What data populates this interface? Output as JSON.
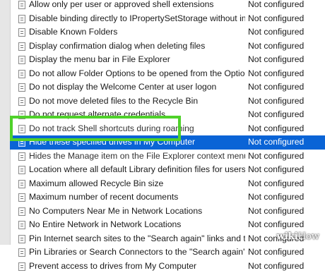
{
  "policy_list": {
    "rows": [
      {
        "name": "Allow only per user or approved shell extensions",
        "state": "Not configured"
      },
      {
        "name": "Disable binding directly to IPropertySetStorage without interm...",
        "state": "Not configured"
      },
      {
        "name": "Disable Known Folders",
        "state": "Not configured"
      },
      {
        "name": "Display confirmation dialog when deleting files",
        "state": "Not configured"
      },
      {
        "name": "Display the menu bar in File Explorer",
        "state": "Not configured"
      },
      {
        "name": "Do not allow Folder Options to be opened from the Options b...",
        "state": "Not configured"
      },
      {
        "name": "Do not display the Welcome Center at user logon",
        "state": "Not configured"
      },
      {
        "name": "Do not move deleted files to the Recycle Bin",
        "state": "Not configured"
      },
      {
        "name": "Do not request alternate credentials",
        "state": "Not configured"
      },
      {
        "name": "Do not track Shell shortcuts during roaming",
        "state": "Not configured"
      },
      {
        "name": "Hide these specified drives in My Computer",
        "state": "Not configured"
      },
      {
        "name": "Hides the Manage item on the File Explorer context menu",
        "state": "Not configured"
      },
      {
        "name": "Location where all default Library definition files for users/mach...",
        "state": "Not configured"
      },
      {
        "name": "Maximum allowed Recycle Bin size",
        "state": "Not configured"
      },
      {
        "name": "Maximum number of recent documents",
        "state": "Not configured"
      },
      {
        "name": "No Computers Near Me in Network Locations",
        "state": "Not configured"
      },
      {
        "name": "No Entire Network in Network Locations",
        "state": "Not configured"
      },
      {
        "name": "Pin Internet search sites to the \"Search again\" links and the Star...",
        "state": "Not configured"
      },
      {
        "name": "Pin Libraries or Search Connectors to the \"Search again\" links a...",
        "state": "Not configured"
      },
      {
        "name": "Prevent access to drives from My Computer",
        "state": "Not configured"
      }
    ]
  },
  "watermark": {
    "brand": "wiki",
    "suffix": "How"
  }
}
